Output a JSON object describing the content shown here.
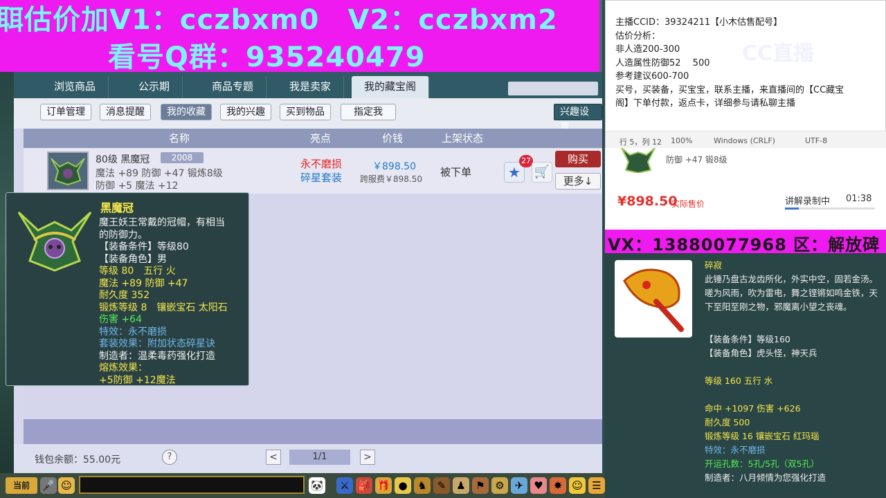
{
  "banner": {
    "line1": "聑估价加V1：cczbxm0　V2：cczbxm2",
    "line2": "看号Q群：935240479"
  },
  "shop": {
    "tabs": [
      "浏览商品",
      "公示期",
      "商品专题",
      "我是卖家",
      "我的藏宝阁"
    ],
    "subtabs": [
      "订单管理",
      "消息提醒",
      "我的收藏",
      "我的兴趣",
      "买到物品",
      "指定我"
    ],
    "sub_right": "兴趣设置",
    "columns": [
      "名称",
      "亮点",
      "价钱",
      "上架状态"
    ],
    "item": {
      "name": "80级 黑魔冠",
      "level_tag": "2008",
      "attr1": "魔法 +89 防御 +47 锻炼8级",
      "attr2": "防御 +5 魔法 +12",
      "highlight1": "永不磨损",
      "highlight2": "碎星套装",
      "price": "￥898.50",
      "fee": "跨服费￥898.50",
      "status": "被下单",
      "favorites": "27",
      "buy": "购买",
      "more": "更多↓"
    },
    "wallet": "钱包余额：55.00元",
    "help": "?",
    "page": "1/1",
    "prev": "<",
    "next": ">"
  },
  "tooltip": {
    "title": "黑魔冠",
    "lines": [
      {
        "text": "魔王妖王常戴的冠帽，有相当",
        "color": "w"
      },
      {
        "text": "的防御力。",
        "color": "w"
      },
      {
        "text": "【装备条件】等级80",
        "color": "w"
      },
      {
        "text": "【装备角色】男",
        "color": "w"
      },
      {
        "text": "等级 80　五行 火",
        "color": "y"
      },
      {
        "text": "魔法 +89 防御 +47",
        "color": "y"
      },
      {
        "text": "耐久度 352",
        "color": "y"
      },
      {
        "text": "锻炼等级 8　镶嵌宝石 太阳石",
        "color": "y"
      },
      {
        "text": "伤害 +64",
        "color": "g"
      },
      {
        "text": "特效：永不磨损",
        "color": "b"
      },
      {
        "text": "套装效果：附加状态碎星诀",
        "color": "b"
      },
      {
        "text": "制造者：温柔毒药强化打造",
        "color": "w"
      },
      {
        "text": "熔炼效果：",
        "color": "y"
      },
      {
        "text": "+5防御 +12魔法",
        "color": "y"
      }
    ]
  },
  "gamebar": {
    "now": "当前"
  },
  "notepad": {
    "lines": [
      "主播CCID：39324211【小木估售配号】",
      "估价分析：",
      "非人造200-300",
      "人造属性防御52　 500",
      "参考建议600-700",
      "买号，买装备，买宝宝，联系主播，来直播间的【CC藏宝",
      "阁】下单付款，返点卡，详细参与请私聊主播"
    ],
    "status": {
      "position": "行 5，列 12",
      "zoom": "100%",
      "eol": "Windows (CRLF)",
      "encoding": "UTF-8"
    },
    "watermark": "CC直播"
  },
  "card": {
    "attr": "防御 +47 锻8级",
    "price": "¥898.50",
    "price_label": "实际售价",
    "live": "讲解录制中",
    "time": "01:38",
    "progress": 0.15
  },
  "vx": {
    "text": "VX：13880077968 区：解放碑"
  },
  "detail": {
    "name": "碎寂",
    "desc": "此锤乃盘古龙齿所化，外实中空，固若金汤。嗟为风雨，吹为雷电，舞之铿锵如鸣金铁，天下至阳至刚之物，邪魔离小望之丧魂。",
    "lines": [
      {
        "text": "【装备条件】等级160",
        "color": "w"
      },
      {
        "text": "【装备角色】虎头怪，神天兵",
        "color": "w"
      },
      {
        "text": "等级 160 五行 水",
        "color": "y"
      },
      {
        "text": "命中 +1097 伤害 +626",
        "color": "y"
      },
      {
        "text": "耐久度 500",
        "color": "y"
      },
      {
        "text": "锻炼等级 16 镶嵌宝石 红玛瑙",
        "color": "y"
      },
      {
        "text": "特效：永不磨损",
        "color": "b"
      },
      {
        "text": "开运孔数：5孔/5孔（双5孔）",
        "color": "g"
      },
      {
        "text": "制造者：八月倾情为您强化打造",
        "color": "w"
      }
    ]
  }
}
